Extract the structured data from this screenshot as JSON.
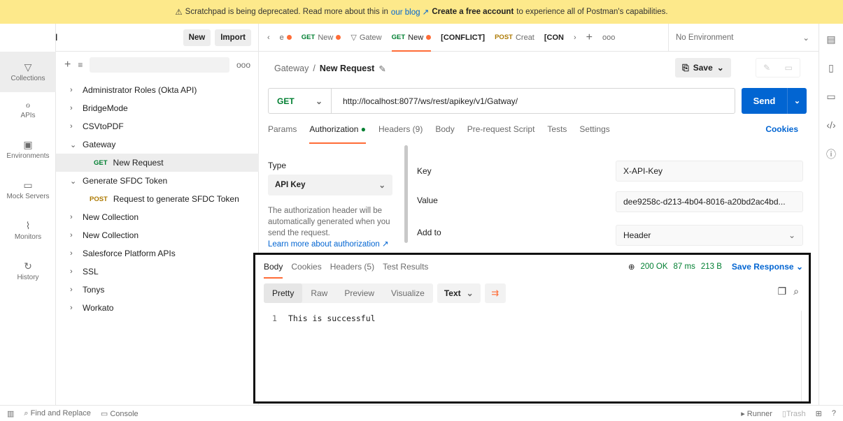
{
  "banner": {
    "text": "Scratchpad is being deprecated. Read more about this in",
    "link": "our blog ↗",
    "cta": "Create a free account",
    "tail": "to experience all of Postman's capabilities."
  },
  "scratchpad": {
    "title": "Scratch Pad",
    "new_label": "New",
    "import_label": "Import"
  },
  "leftnav": [
    {
      "label": "Collections",
      "icon": "collections-icon"
    },
    {
      "label": "APIs",
      "icon": "apis-icon"
    },
    {
      "label": "Environments",
      "icon": "environments-icon"
    },
    {
      "label": "Mock Servers",
      "icon": "mock-servers-icon"
    },
    {
      "label": "Monitors",
      "icon": "monitors-icon"
    },
    {
      "label": "History",
      "icon": "history-icon"
    }
  ],
  "tree": [
    {
      "label": "Administrator Roles (Okta API)"
    },
    {
      "label": "BridgeMode"
    },
    {
      "label": "CSVtoPDF"
    },
    {
      "label": "Gateway"
    },
    {
      "method": "GET",
      "label": "New Request"
    },
    {
      "label": "Generate SFDC Token"
    },
    {
      "method": "POST",
      "label": "Request to generate SFDC Token"
    },
    {
      "label": "New Collection"
    },
    {
      "label": "New Collection"
    },
    {
      "label": "Salesforce Platform APIs"
    },
    {
      "label": "SSL"
    },
    {
      "label": "Tonys"
    },
    {
      "label": "Workato"
    }
  ],
  "tabs": [
    {
      "label": "e"
    },
    {
      "method": "GET",
      "label": "New"
    },
    {
      "label": "Gatew"
    },
    {
      "method": "GET",
      "label": "New"
    },
    {
      "label": "[CONFLICT]"
    },
    {
      "method": "POST",
      "label": "Creat"
    },
    {
      "label": "[CON"
    }
  ],
  "environment": "No Environment",
  "request": {
    "breadcrumb_parent": "Gateway",
    "breadcrumb_sep": "/",
    "name": "New Request",
    "save_label": "Save",
    "method": "GET",
    "url": "http://localhost:8077/ws/rest/apikey/v1/Gatway/",
    "send_label": "Send",
    "tabs": [
      "Params",
      "Authorization",
      "Headers (9)",
      "Body",
      "Pre-request Script",
      "Tests",
      "Settings"
    ],
    "cookies_label": "Cookies"
  },
  "auth": {
    "type_label": "Type",
    "type_value": "API Key",
    "help": "The authorization header will be automatically generated when you send the request.",
    "help_link": "Learn more about authorization ↗",
    "key_label": "Key",
    "key_value": "X-API-Key",
    "value_label": "Value",
    "value_value": "dee9258c-d213-4b04-8016-a20bd2ac4bd...",
    "addto_label": "Add to",
    "addto_value": "Header"
  },
  "response": {
    "tabs": [
      "Body",
      "Cookies",
      "Headers (5)",
      "Test Results"
    ],
    "status": "200 OK",
    "time": "87 ms",
    "size": "213 B",
    "save_label": "Save Response",
    "formats": [
      "Pretty",
      "Raw",
      "Preview",
      "Visualize"
    ],
    "text_format": "Text",
    "line_number": "1",
    "body": "This is successful"
  },
  "footer": {
    "find_replace": "Find and Replace",
    "console": "Console",
    "runner": "Runner",
    "trash": "Trash"
  }
}
